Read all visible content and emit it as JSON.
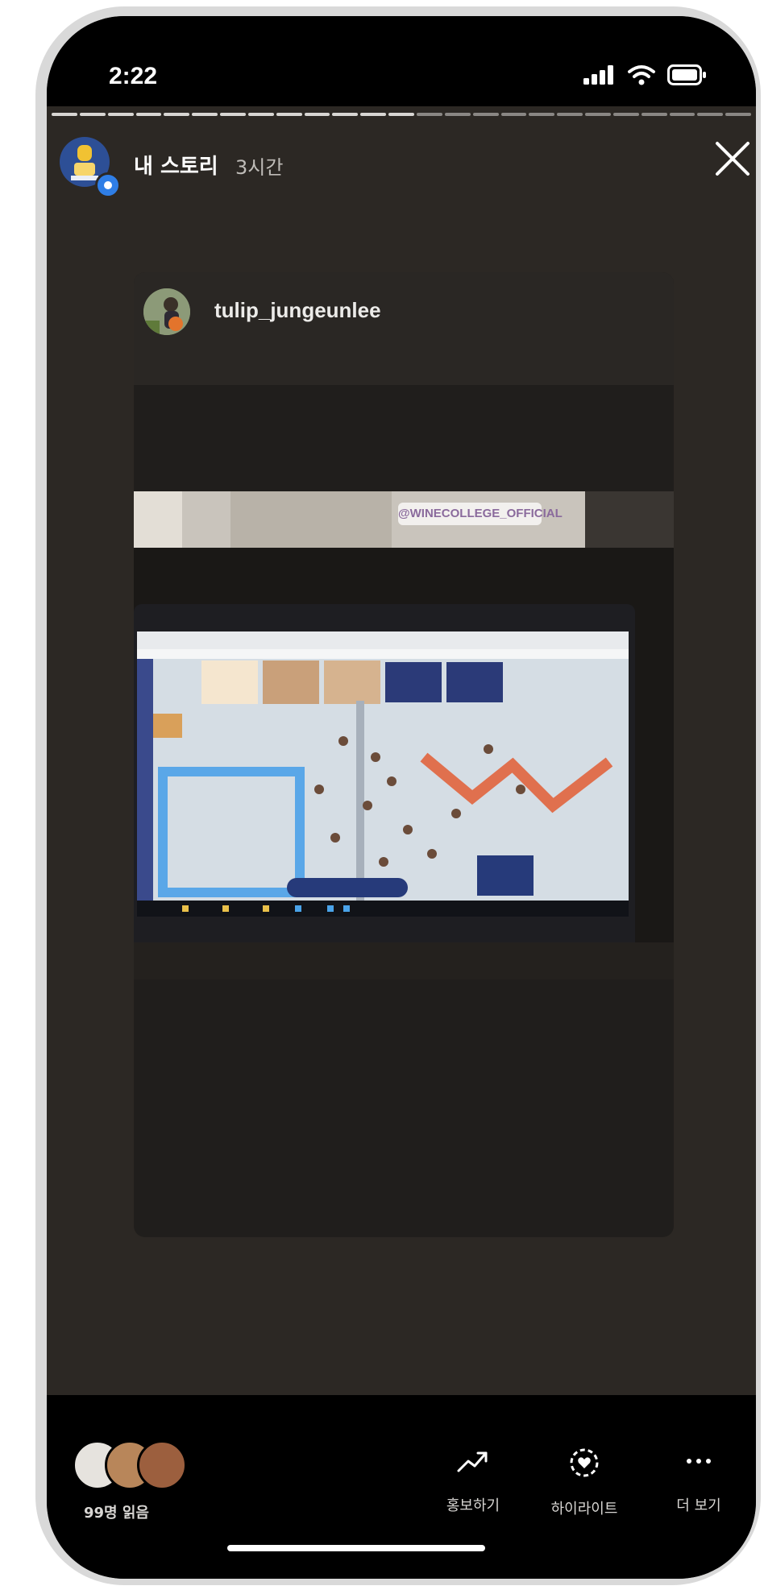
{
  "status_bar": {
    "time": "2:22",
    "signal_icon": "cellular-signal-icon",
    "wifi_icon": "wifi-icon",
    "battery_icon": "battery-icon"
  },
  "story_progress": {
    "segments_total": 25,
    "segments_done": 13
  },
  "header": {
    "title": "내 스토리",
    "elapsed": "3시간",
    "close_icon": "close-icon"
  },
  "shared_post": {
    "username": "tulip_jungeunlee",
    "photo_hashtag": "@WINECOLLEGE_OFFICIAL"
  },
  "footer": {
    "viewers_label": "99명 읽음",
    "actions": [
      {
        "label": "홍보하기",
        "icon": "trending-up-icon"
      },
      {
        "label": "하이라이트",
        "icon": "highlight-heart-icon"
      },
      {
        "label": "더 보기",
        "icon": "more-dots-icon"
      }
    ]
  },
  "colors": {
    "background": "#2c2824",
    "accent_blue": "#2f7ee6"
  }
}
